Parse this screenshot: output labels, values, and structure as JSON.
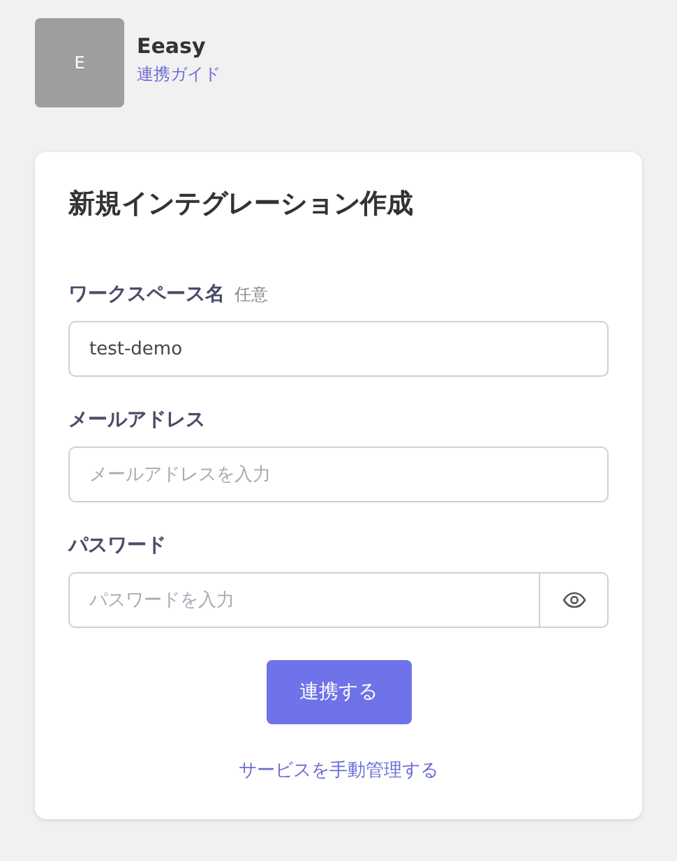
{
  "app": {
    "logo_letter": "E",
    "name": "Eeasy",
    "guide_link": "連携ガイド"
  },
  "form": {
    "title": "新規インテグレーション作成",
    "fields": [
      {
        "kind": "text",
        "label": "ワークスペース名",
        "hint": "任意",
        "value": "test-demo"
      },
      {
        "kind": "text",
        "label": "メールアドレス",
        "placeholder": "メールアドレスを入力"
      },
      {
        "kind": "password",
        "label": "パスワード",
        "placeholder": "パスワードを入力"
      }
    ],
    "submit": "連携する",
    "manual_link": "サービスを手動管理する"
  }
}
